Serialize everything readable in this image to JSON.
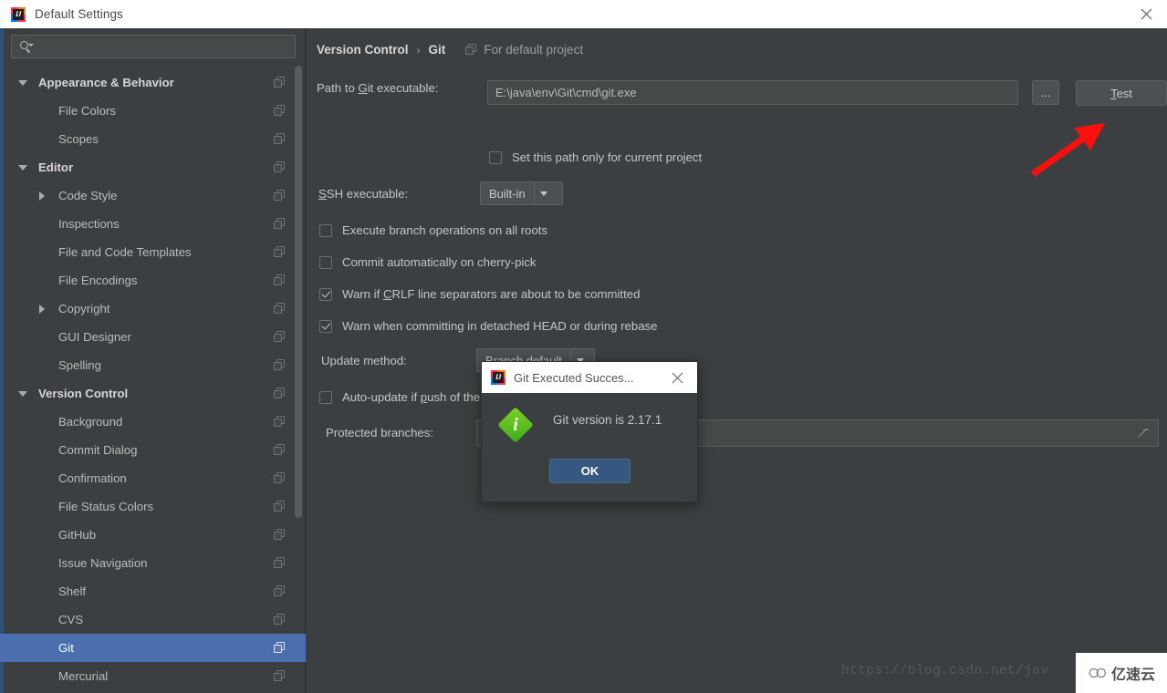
{
  "window": {
    "title": "Default Settings",
    "icon": "intellij-idea-logo",
    "close_label": "✕"
  },
  "sidebar": {
    "search": {
      "placeholder": "",
      "value": "",
      "icon": "search-icon"
    },
    "items": [
      {
        "label": "Appearance & Behavior",
        "level": 0,
        "twisty": "down",
        "group": true,
        "selected": false
      },
      {
        "label": "File Colors",
        "level": 1,
        "twisty": "none",
        "group": false,
        "selected": false
      },
      {
        "label": "Scopes",
        "level": 1,
        "twisty": "none",
        "group": false,
        "selected": false
      },
      {
        "label": "Editor",
        "level": 0,
        "twisty": "down",
        "group": true,
        "selected": false
      },
      {
        "label": "Code Style",
        "level": 1,
        "twisty": "right",
        "group": false,
        "selected": false
      },
      {
        "label": "Inspections",
        "level": 1,
        "twisty": "none",
        "group": false,
        "selected": false
      },
      {
        "label": "File and Code Templates",
        "level": 1,
        "twisty": "none",
        "group": false,
        "selected": false
      },
      {
        "label": "File Encodings",
        "level": 1,
        "twisty": "none",
        "group": false,
        "selected": false
      },
      {
        "label": "Copyright",
        "level": 1,
        "twisty": "right",
        "group": false,
        "selected": false
      },
      {
        "label": "GUI Designer",
        "level": 1,
        "twisty": "none",
        "group": false,
        "selected": false
      },
      {
        "label": "Spelling",
        "level": 1,
        "twisty": "none",
        "group": false,
        "selected": false
      },
      {
        "label": "Version Control",
        "level": 0,
        "twisty": "down",
        "group": true,
        "selected": false
      },
      {
        "label": "Background",
        "level": 1,
        "twisty": "none",
        "group": false,
        "selected": false
      },
      {
        "label": "Commit Dialog",
        "level": 1,
        "twisty": "none",
        "group": false,
        "selected": false
      },
      {
        "label": "Confirmation",
        "level": 1,
        "twisty": "none",
        "group": false,
        "selected": false
      },
      {
        "label": "File Status Colors",
        "level": 1,
        "twisty": "none",
        "group": false,
        "selected": false
      },
      {
        "label": "GitHub",
        "level": 1,
        "twisty": "none",
        "group": false,
        "selected": false
      },
      {
        "label": "Issue Navigation",
        "level": 1,
        "twisty": "none",
        "group": false,
        "selected": false
      },
      {
        "label": "Shelf",
        "level": 1,
        "twisty": "none",
        "group": false,
        "selected": false
      },
      {
        "label": "CVS",
        "level": 1,
        "twisty": "none",
        "group": false,
        "selected": false
      },
      {
        "label": "Git",
        "level": 1,
        "twisty": "none",
        "group": false,
        "selected": true
      },
      {
        "label": "Mercurial",
        "level": 1,
        "twisty": "none",
        "group": false,
        "selected": false
      }
    ]
  },
  "content": {
    "breadcrumb": {
      "parent": "Version Control",
      "separator": "›",
      "current": "Git",
      "note": "For default project"
    },
    "path_row": {
      "label_pre": "Path to ",
      "label_mnemonic": "G",
      "label_post": "it executable:",
      "value": "E:\\java\\env\\Git\\cmd\\git.exe",
      "browse_label": "...",
      "test_label_mnemonic": "T",
      "test_label_rest": "est"
    },
    "set_path_checkbox": {
      "label": "Set this path only for current project",
      "checked": false
    },
    "ssh_row": {
      "label_mnemonic": "S",
      "label_rest": "SH executable:",
      "value": "Built-in"
    },
    "checkboxes": [
      {
        "label": "Execute branch operations on all roots",
        "checked": false
      },
      {
        "label": "Commit automatically on cherry-pick",
        "checked": false
      },
      {
        "label_pre": "Warn if ",
        "label_mnemonic": "C",
        "label_post": "RLF line separators are about to be committed",
        "checked": true
      },
      {
        "label": "Warn when committing in detached HEAD or during rebase",
        "checked": true
      }
    ],
    "update_method": {
      "label": "Update method:",
      "value": "Branch default"
    },
    "auto_update": {
      "label_pre": "Auto-update if ",
      "label_mnemonic": "p",
      "label_post": "ush of the current branch was rejected",
      "checked": false
    },
    "protected_branches": {
      "label": "Protected branches:",
      "value": ""
    }
  },
  "modal": {
    "title": "Git Executed Succes...",
    "icon": "intellij-idea-logo",
    "close_label": "✕",
    "message": "Git version is 2.17.1",
    "ok_label": "OK",
    "status_icon": "info-icon",
    "accent_color": "#365880",
    "info_color": "#55b821"
  },
  "annotation": {
    "arrow_color": "#fa0f0f",
    "target": "test-button"
  },
  "watermark": {
    "url_text": "https://blog.csdn.net/jav",
    "brand_text": "亿速云"
  }
}
